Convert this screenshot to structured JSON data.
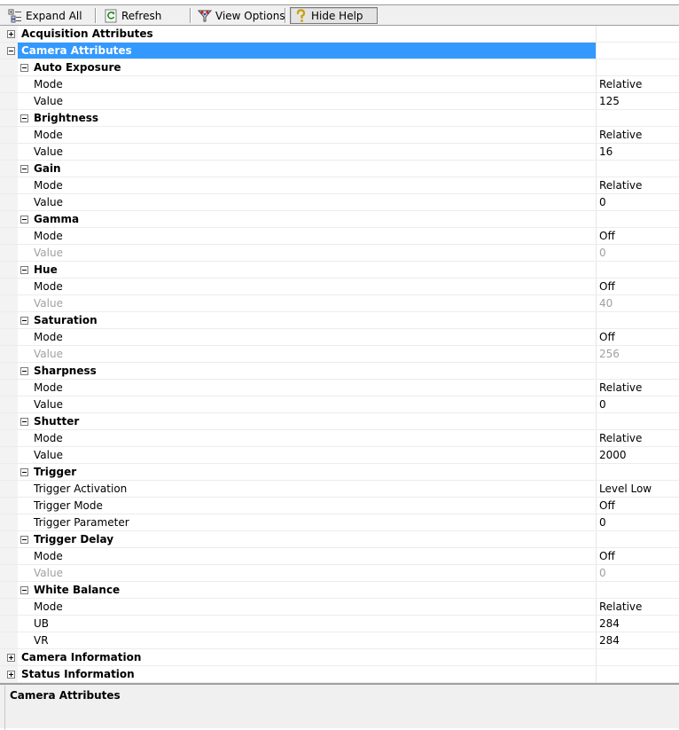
{
  "toolbar": {
    "expand_all": "Expand All",
    "refresh": "Refresh",
    "view_options": "View Options",
    "hide_help": "Hide Help"
  },
  "rows": [
    {
      "kind": "cat",
      "expander": "plus",
      "name": "Acquisition Attributes",
      "value": ""
    },
    {
      "kind": "cat",
      "expander": "minus",
      "name": "Camera Attributes",
      "value": "",
      "selected": true
    },
    {
      "kind": "sub",
      "expander": "minus",
      "name": "Auto Exposure",
      "value": ""
    },
    {
      "kind": "prop",
      "name": "Mode",
      "value": "Relative"
    },
    {
      "kind": "prop",
      "name": "Value",
      "value": "125"
    },
    {
      "kind": "sub",
      "expander": "minus",
      "name": "Brightness",
      "value": ""
    },
    {
      "kind": "prop",
      "name": "Mode",
      "value": "Relative"
    },
    {
      "kind": "prop",
      "name": "Value",
      "value": "16"
    },
    {
      "kind": "sub",
      "expander": "minus",
      "name": "Gain",
      "value": ""
    },
    {
      "kind": "prop",
      "name": "Mode",
      "value": "Relative"
    },
    {
      "kind": "prop",
      "name": "Value",
      "value": "0"
    },
    {
      "kind": "sub",
      "expander": "minus",
      "name": "Gamma",
      "value": ""
    },
    {
      "kind": "prop",
      "name": "Mode",
      "value": "Off"
    },
    {
      "kind": "prop",
      "name": "Value",
      "value": "0",
      "disabled": true
    },
    {
      "kind": "sub",
      "expander": "minus",
      "name": "Hue",
      "value": ""
    },
    {
      "kind": "prop",
      "name": "Mode",
      "value": "Off"
    },
    {
      "kind": "prop",
      "name": "Value",
      "value": "40",
      "disabled": true
    },
    {
      "kind": "sub",
      "expander": "minus",
      "name": "Saturation",
      "value": ""
    },
    {
      "kind": "prop",
      "name": "Mode",
      "value": "Off"
    },
    {
      "kind": "prop",
      "name": "Value",
      "value": "256",
      "disabled": true
    },
    {
      "kind": "sub",
      "expander": "minus",
      "name": "Sharpness",
      "value": ""
    },
    {
      "kind": "prop",
      "name": "Mode",
      "value": "Relative"
    },
    {
      "kind": "prop",
      "name": "Value",
      "value": "0"
    },
    {
      "kind": "sub",
      "expander": "minus",
      "name": "Shutter",
      "value": ""
    },
    {
      "kind": "prop",
      "name": "Mode",
      "value": "Relative"
    },
    {
      "kind": "prop",
      "name": "Value",
      "value": "2000"
    },
    {
      "kind": "sub",
      "expander": "minus",
      "name": "Trigger",
      "value": ""
    },
    {
      "kind": "prop",
      "name": "Trigger Activation",
      "value": "Level Low"
    },
    {
      "kind": "prop",
      "name": "Trigger Mode",
      "value": "Off"
    },
    {
      "kind": "prop",
      "name": "Trigger Parameter",
      "value": "0"
    },
    {
      "kind": "sub",
      "expander": "minus",
      "name": "Trigger Delay",
      "value": ""
    },
    {
      "kind": "prop",
      "name": "Mode",
      "value": "Off"
    },
    {
      "kind": "prop",
      "name": "Value",
      "value": "0",
      "disabled": true
    },
    {
      "kind": "sub",
      "expander": "minus",
      "name": "White Balance",
      "value": ""
    },
    {
      "kind": "prop",
      "name": "Mode",
      "value": "Relative"
    },
    {
      "kind": "prop",
      "name": "UB",
      "value": "284"
    },
    {
      "kind": "prop",
      "name": "VR",
      "value": "284"
    },
    {
      "kind": "cat",
      "expander": "plus",
      "name": "Camera Information",
      "value": ""
    },
    {
      "kind": "cat",
      "expander": "plus",
      "name": "Status Information",
      "value": ""
    }
  ],
  "help": {
    "title": "Camera Attributes"
  },
  "colors": {
    "selection": "#3399ff",
    "disabled_text": "#a0a0a0",
    "toolbar_bg": "#f0f0f0"
  },
  "icons": {
    "expand_all": "expand-all-icon",
    "refresh": "refresh-icon",
    "view_options": "view-options-icon",
    "hide_help": "help-icon"
  }
}
